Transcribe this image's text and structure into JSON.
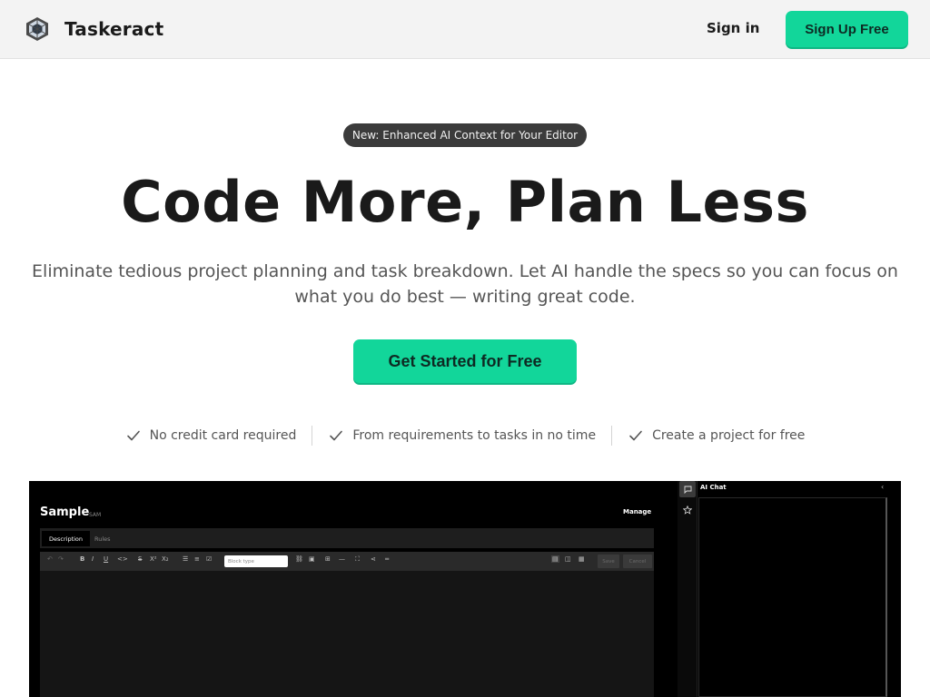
{
  "header": {
    "brand": "Taskeract",
    "logo_icon": "cube-logo-icon",
    "signin_label": "Sign in",
    "signup_label": "Sign Up Free"
  },
  "hero": {
    "badge": "New: Enhanced AI Context for Your Editor",
    "title": "Code More, Plan Less",
    "subtitle": "Eliminate tedious project planning and task breakdown. Let AI handle the specs so you can focus on what you do best — writing great code.",
    "cta_label": "Get Started for Free"
  },
  "features": [
    {
      "icon": "check-icon",
      "label": "No credit card required"
    },
    {
      "icon": "check-icon",
      "label": "From requirements to tasks in no time"
    },
    {
      "icon": "check-icon",
      "label": "Create a project for free"
    }
  ],
  "preview": {
    "title": "Sample",
    "subtitle": "SAM",
    "manage_label": "Manage",
    "tabs": [
      "Description",
      "Rules"
    ],
    "toolbar": {
      "block_type_placeholder": "Block type",
      "save_label": "Save",
      "cancel_label": "Cancel"
    },
    "chat_title": "AI Chat"
  },
  "colors": {
    "accent": "#12d69a",
    "nav_bg": "#f3f3f3",
    "badge_bg": "#3b3b3b",
    "preview_bg": "#000000"
  }
}
